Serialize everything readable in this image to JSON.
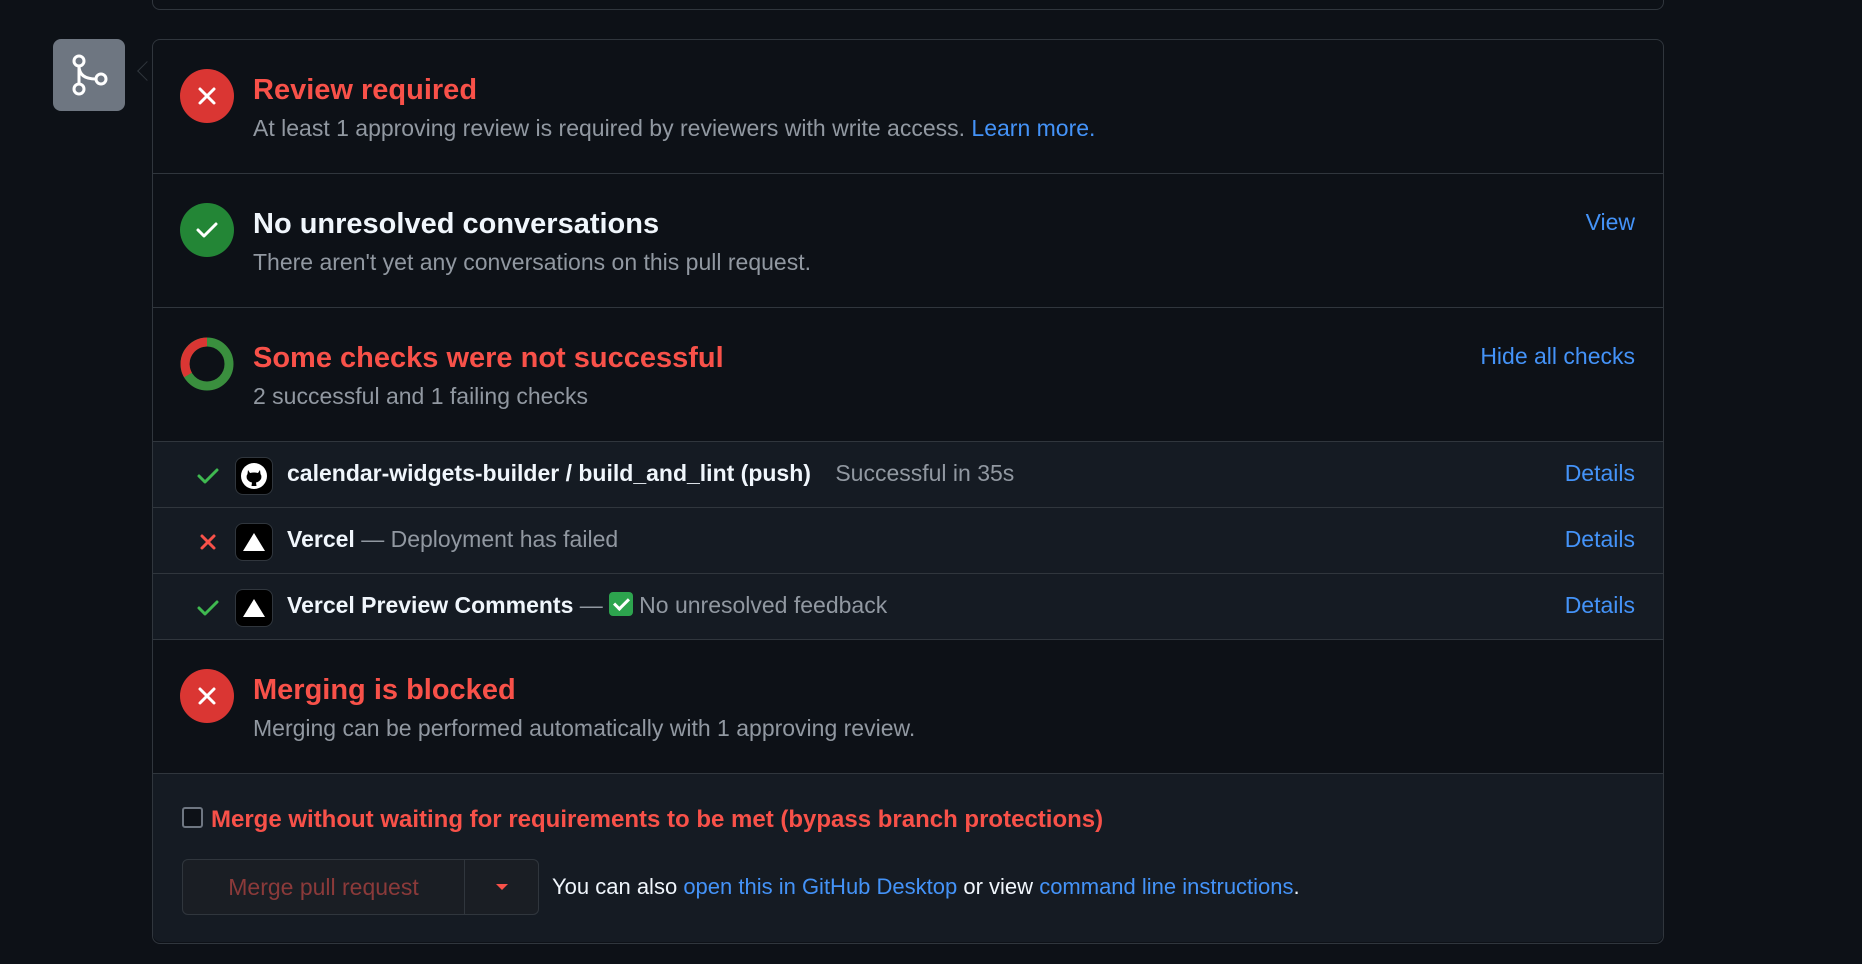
{
  "colors": {
    "danger": "#f85149",
    "success": "#3fb950",
    "link": "#4493f8",
    "muted": "#9198a1",
    "background": "#0d1117"
  },
  "merge_icon": {
    "name": "git-merge-icon"
  },
  "sections": {
    "review": {
      "title": "Review required",
      "description": "At least 1 approving review is required by reviewers with write access.",
      "link": "Learn more.",
      "icon": "x-circle-icon"
    },
    "conversations": {
      "title": "No unresolved conversations",
      "description": "There aren't yet any conversations on this pull request.",
      "action": "View",
      "icon": "check-circle-icon"
    },
    "checks": {
      "title": "Some checks were not successful",
      "description": "2 successful and 1 failing checks",
      "action": "Hide all checks",
      "icon": "donut-status-icon",
      "successful": 2,
      "failing": 1
    },
    "blocked": {
      "title": "Merging is blocked",
      "description": "Merging can be performed automatically with 1 approving review.",
      "icon": "x-circle-icon"
    }
  },
  "check_runs": [
    {
      "status": "success",
      "name": "calendar-widgets-builder / build_and_lint (push)",
      "separator": "",
      "description": "Successful in 35s",
      "details": "Details",
      "avatar": "github-icon"
    },
    {
      "status": "failure",
      "name": "Vercel",
      "separator": "—",
      "description": "Deployment has failed",
      "details": "Details",
      "avatar": "vercel-icon"
    },
    {
      "status": "success",
      "name": "Vercel Preview Comments",
      "separator": "—",
      "description": "No unresolved feedback",
      "details": "Details",
      "avatar": "vercel-icon"
    }
  ],
  "merge": {
    "bypass_label": "Merge without waiting for requirements to be met (bypass branch protections)",
    "bypass_checked": false,
    "button_label": "Merge pull request",
    "hint_prefix": "You can also",
    "desktop_link": "open this in GitHub Desktop",
    "hint_middle": "or view",
    "cli_link": "command line instructions",
    "hint_suffix": "."
  }
}
